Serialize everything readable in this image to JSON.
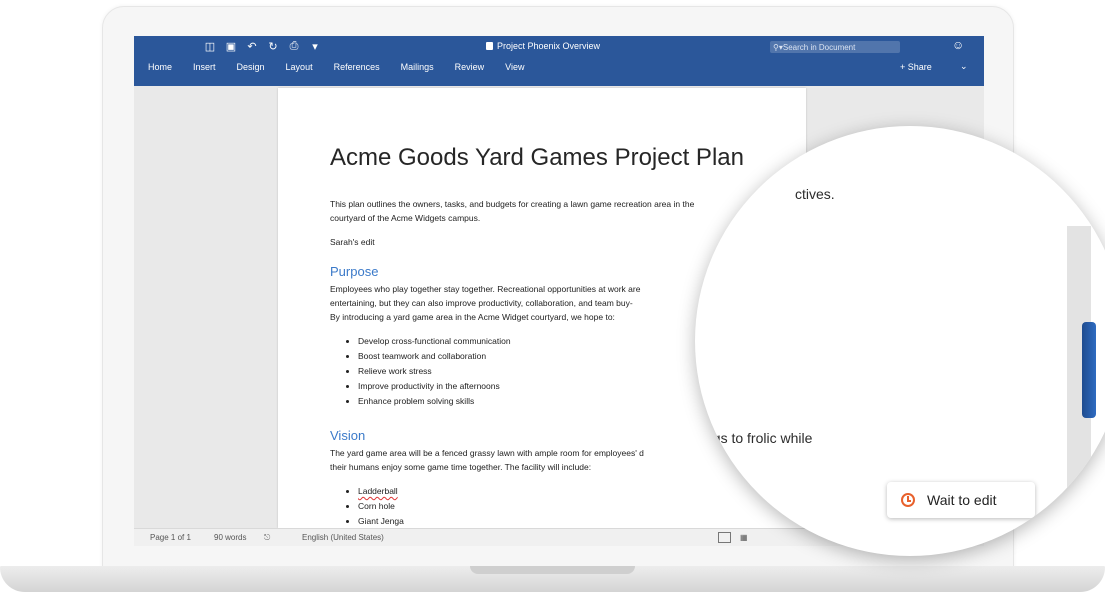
{
  "ribbon": {
    "doc_title": "Project Phoenix Overview",
    "search_placeholder": "Search in Document",
    "tabs": [
      "Home",
      "Insert",
      "Design",
      "Layout",
      "References",
      "Mailings",
      "Review",
      "View"
    ],
    "share_label": "Share",
    "accent_color": "#2b579a"
  },
  "document": {
    "title": "Acme Goods Yard Games Project Plan",
    "intro_line1": "This plan outlines the owners, tasks, and budgets for creating a lawn game recreation area in the",
    "intro_line2": "courtyard of the Acme Widgets campus.",
    "edit_note": "Sarah's edit",
    "purpose_heading": "Purpose",
    "purpose_line1": "Employees who play together stay together. Recreational opportunities at work are",
    "purpose_line2": "entertaining, but they can also improve productivity, collaboration, and team buy-",
    "purpose_line3": "By introducing a yard game area in the Acme Widget courtyard, we hope to:",
    "purpose_bullets": [
      "Develop cross-functional communication",
      "Boost teamwork and collaboration",
      "Relieve work stress",
      "Improve productivity in the afternoons",
      "Enhance problem solving skills"
    ],
    "vision_heading": "Vision",
    "vision_line1": "The yard game area will be a fenced grassy lawn with ample room for employees' d",
    "vision_line2": "their humans enjoy some game time together. The facility will include:",
    "vision_bullets": [
      "Ladderball",
      "Corn hole",
      "Giant Jenga"
    ]
  },
  "status": {
    "page": "Page 1 of 1",
    "words": "90 words",
    "language": "English (United States)"
  },
  "magnifier": {
    "text_top": "ctives.",
    "text_mid": "ngs to frolic while",
    "wait_label": "Wait to edit",
    "clock_color": "#e8612c"
  }
}
